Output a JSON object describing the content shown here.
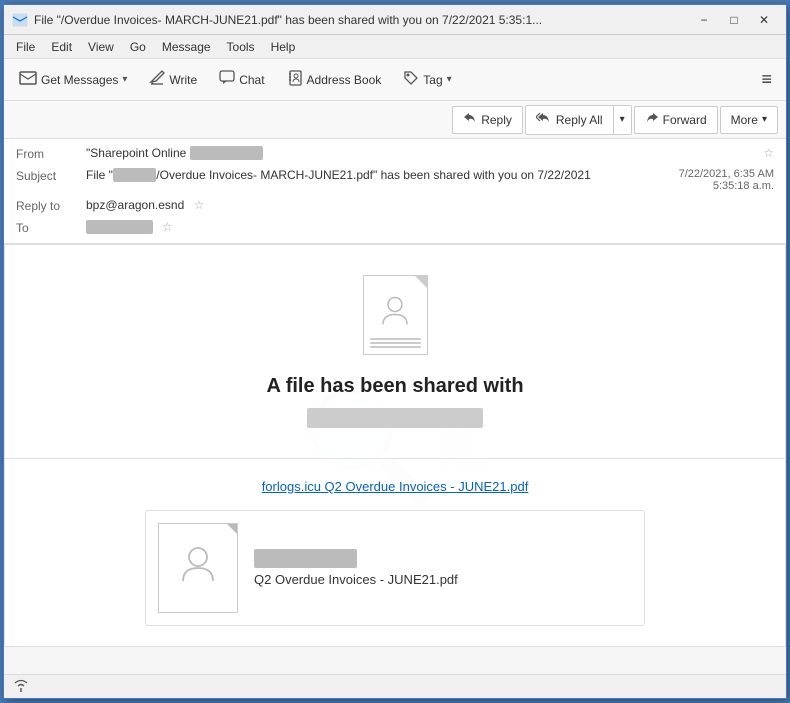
{
  "window": {
    "title": "File \"/Overdue Invoices- MARCH-JUNE21.pdf\" has been shared with you on 7/22/2021 5:35:1...",
    "minimize": "−",
    "maximize": "□",
    "close": "✕"
  },
  "menubar": {
    "items": [
      "File",
      "Edit",
      "View",
      "Go",
      "Message",
      "Tools",
      "Help"
    ]
  },
  "toolbar": {
    "get_messages": "Get Messages",
    "write": "Write",
    "chat": "Chat",
    "address_book": "Address Book",
    "tag": "Tag",
    "tag_arrow": "▾"
  },
  "actions": {
    "reply": "Reply",
    "reply_all": "Reply All",
    "reply_all_dropdown": "▾",
    "forward": "Forward",
    "more": "More",
    "more_dropdown": "▾"
  },
  "headers": {
    "from_label": "From",
    "from_value": "\"Sharepoint Online",
    "from_blurred": "████████████████",
    "from_star": "☆",
    "subject_label": "Subject",
    "subject_value": "File \"",
    "subject_blurred": "███████████",
    "subject_middle": "/Overdue Invoices- MARCH-JUNE21.pdf\" has been shared with you on 7/22/2021",
    "subject_time": "7/22/2021, 6:35 AM 5:35:18 a.m.",
    "reply_to_label": "Reply to",
    "reply_to_value": "bpz@aragon.esnd",
    "reply_to_star": "☆",
    "to_label": "To",
    "to_blurred": "████████████████",
    "to_star": "☆"
  },
  "email_body": {
    "file_shared_title": "A file has been shared with",
    "file_shared_email_blurred": "████████████████████████████",
    "link_text": "forlogs.icu Q2 Overdue Invoices - JUNE21.pdf",
    "file_card_blurred": "████████████████████",
    "file_card_name": "Q2 Overdue Invoices - JUNE21.pdf"
  },
  "status_bar": {
    "wifi_label": "Connected"
  }
}
